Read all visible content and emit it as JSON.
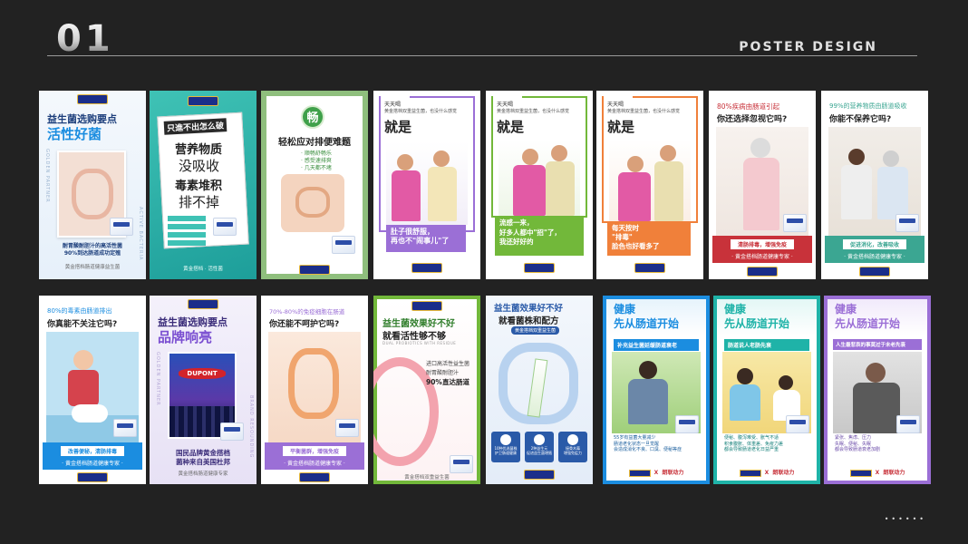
{
  "header": {
    "section_number": "01",
    "label": "POSTER DESIGN"
  },
  "footer": {
    "dots": "••••••"
  },
  "common": {
    "brand_footer": "黄金搭档肠道健康专家",
    "dotted_brand_footer": "· 黄金搭档肠道健康专家 ·",
    "partner_x": "X",
    "partner_name": "朗联动力"
  },
  "posters": {
    "p1": {
      "title_line1": "益生菌选购要点",
      "title_line2": "活性好菌",
      "side_text": "GOLDEN PARTNER",
      "side_text2": "ACTIVE BACTERIA",
      "caption": "耐胃酸耐胆汁的高活性菌\n90%到达肠道成功定殖",
      "footer": "黄金搭档肠道健康益生菌"
    },
    "p2": {
      "top": "只進不出怎么破",
      "line1": "营养物质",
      "line2": "没吸收",
      "line3": "毒素堆积",
      "line4": "排不掉",
      "footer": "黄金搭档 · 活性菌"
    },
    "p3": {
      "badge": "畅",
      "title": "轻松应对排便难题",
      "bullets": "· 顺畅舒畅乐\n· 感受速排爽\n· 几天都不堵"
    },
    "p4": {
      "top_small": "天天喝",
      "intro": "黄金搭档双重益生菌，也没什么感觉",
      "big": "就是",
      "caption_line1": "肚子很舒服，",
      "caption_line2": "再也不\"闹事儿\"了"
    },
    "p5": {
      "top_small": "天天喝",
      "intro": "黄金搭档双重益生菌，也没什么感觉",
      "big": "就是",
      "caption_line1": "流感一来，",
      "caption_line2": "好多人都中\"招\"了，",
      "caption_line3": "我还好好的"
    },
    "p6": {
      "top_small": "天天喝",
      "intro": "黄金搭档双重益生菌，也没什么感觉",
      "big": "就是",
      "caption_line1": "每天按时",
      "caption_line2": "\"排毒\"",
      "caption_line3": "脸色也好看多了"
    },
    "p7": {
      "line1": "80%疾病由肠道引起",
      "line2": "你还选择忽视它吗?",
      "band": "清肠排毒，增强免疫"
    },
    "p8": {
      "line1": "99%的营养物质由肠道吸收",
      "line2": "你能不保养它吗?",
      "band": "促进消化，改善吸收"
    },
    "p9": {
      "line1": "80%的毒素由肠道排出",
      "line2": "你真能不关注它吗?",
      "band": "改善便秘，清肠排毒"
    },
    "p10": {
      "title_line1": "益生菌选购要点",
      "title_line2": "品牌响亮",
      "side_text": "GOLDEN PARTNER",
      "side_text2": "BRAND RESOUNDING",
      "sign": "DUPONT",
      "caption_line1": "国民品牌黄金搭档",
      "caption_line2": "菌种来自美国杜邦"
    },
    "p11": {
      "line1": "70%-80%的免疫细胞在肠道",
      "line2": "你还能不呵护它吗?",
      "band": "平衡菌群，增强免疫"
    },
    "p12": {
      "title_line1": "益生菌效果好不好",
      "title_line2": "就看活性够不够",
      "sub": "DUAL PROBIOTICS WITH RESIDUE",
      "point_line1": "进口高活性益生菌",
      "point_line2": "耐胃酸耐胆汁",
      "point_line3": "90%直达肠道",
      "footer": "黄金搭档双重益生菌"
    },
    "p13": {
      "title_line1": "益生菌效果好不好",
      "title_line2": "就看菌株和配方",
      "chip": "黄金搭档双重益生菌",
      "feat1": "10种优选菌株\n护卫肠道健康",
      "feat2": "2种益生元\n促进益生菌增殖",
      "feat3": "接骨木莓\n增强免疫力"
    },
    "p14": {
      "title_line1": "健康",
      "title_line2": "先从肠道开始",
      "band": "补充益生菌延缓肠道衰老",
      "note": "55岁有益菌大量减少\n肠道老化状态一旦觉醒\n会造成消化不良、口臭、便秘等症"
    },
    "p15": {
      "title_line1": "健康",
      "title_line2": "先从肠道开始",
      "band": "肠道说人老肠先衰",
      "note": "便秘、腹泻难受、胀气不适\n积食腹胀、体重差、免疫力差\n都会导致肠道老化日益严重"
    },
    "p16": {
      "title_line1": "健康",
      "title_line2": "先从肠道开始",
      "band": "人生最悲哀的事莫过于未老先衰",
      "note": "紧张、焦虑、压力\n失眠、便秘、失眠\n都会导致肠道衰老加剧"
    }
  },
  "colors": {
    "background": "#222222",
    "accent_blue": "#1b8de0",
    "brand_navy": "#1b2e8a",
    "brand_gold": "#e7b93b",
    "teal": "#1fb3a8",
    "sage": "#8fbf7d",
    "purple": "#9b6fd6",
    "green": "#72b83a",
    "orange": "#f0803a",
    "red": "#c8323a",
    "emerald": "#3ba692"
  }
}
